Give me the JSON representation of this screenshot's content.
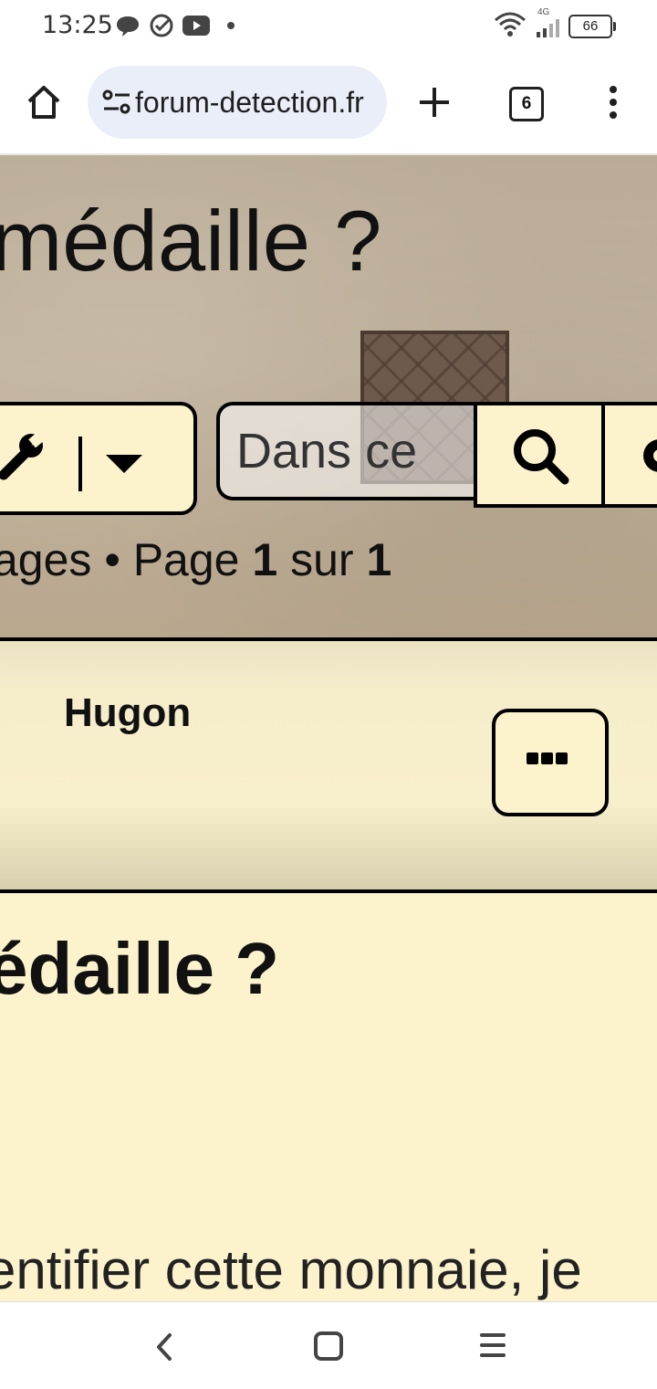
{
  "status_bar": {
    "time": "13:25",
    "network_label": "4G",
    "battery": "66",
    "icons": [
      "chat-bubble-icon",
      "check-circle-icon",
      "youtube-icon",
      "dot-icon",
      "wifi-icon",
      "cell-signal-icon",
      "battery-icon"
    ]
  },
  "browser": {
    "url": "forum-detection.fr",
    "tab_count": "6",
    "icons": [
      "home-icon",
      "site-settings-icon",
      "new-tab-icon",
      "tab-switcher-icon",
      "menu-icon"
    ]
  },
  "page": {
    "hero_title": "médaille ?",
    "search_placeholder": "Dans ce",
    "pagination": {
      "prefix": "ages • Page ",
      "current": "1",
      "separator": " sur ",
      "total": "1"
    },
    "post": {
      "author": "Hugon",
      "title": "édaille ?",
      "body_excerpt": "entifier cette monnaie, je"
    }
  },
  "nav_bar": {
    "icons": [
      "back-icon",
      "home-square-icon",
      "recents-icon"
    ]
  }
}
